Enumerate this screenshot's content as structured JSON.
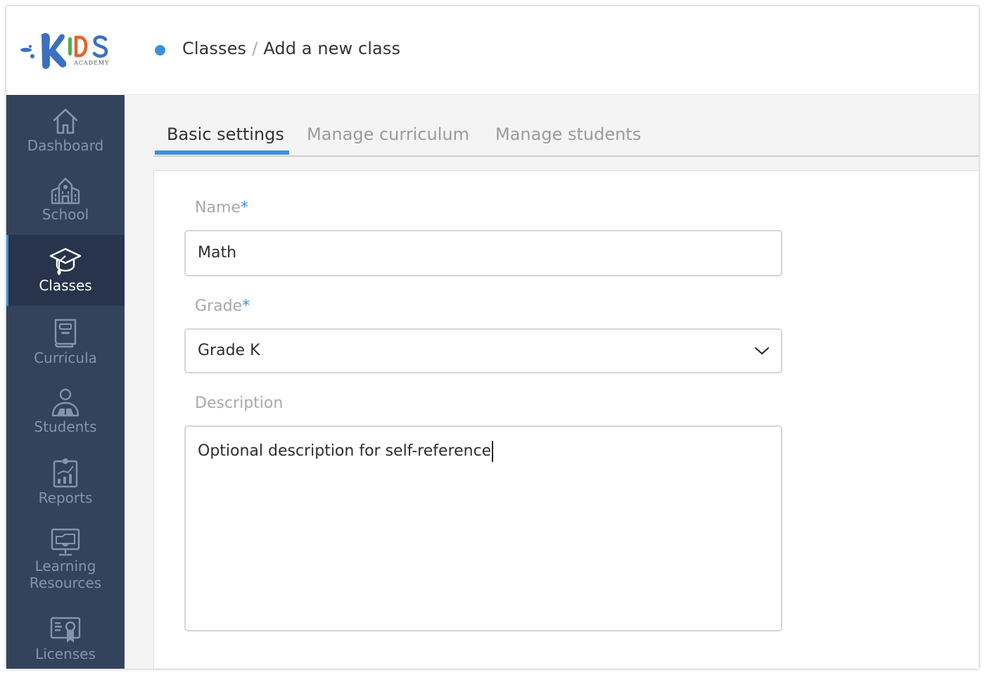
{
  "app": {
    "logo_text": "KIDS",
    "logo_subtext": "ACADEMY",
    "brand_colors": {
      "primary": "#3b6fc1",
      "green": "#4caf50",
      "orange": "#e8612c",
      "accent": "#3b92e0"
    }
  },
  "header": {
    "breadcrumb": {
      "parent": "Classes",
      "separator": "/",
      "current": "Add a new class"
    }
  },
  "sidebar": {
    "items": [
      {
        "label": "Dashboard",
        "icon": "home-icon",
        "active": false
      },
      {
        "label": "School",
        "icon": "school-building-icon",
        "active": false
      },
      {
        "label": "Classes",
        "icon": "graduation-cap-icon",
        "active": true
      },
      {
        "label": "Curricula",
        "icon": "book-icon",
        "active": false
      },
      {
        "label": "Students",
        "icon": "student-reading-icon",
        "active": false
      },
      {
        "label": "Reports",
        "icon": "report-chart-icon",
        "active": false
      },
      {
        "label": "Learning Resources",
        "label_line1": "Learning",
        "label_line2": "Resources",
        "icon": "monitor-folder-icon",
        "active": false
      },
      {
        "label": "Licenses",
        "icon": "certificate-icon",
        "active": false
      }
    ]
  },
  "tabs": [
    {
      "label": "Basic settings",
      "active": true
    },
    {
      "label": "Manage curriculum",
      "active": false
    },
    {
      "label": "Manage students",
      "active": false
    }
  ],
  "form": {
    "name": {
      "label": "Name",
      "required_mark": "*",
      "value": "Math"
    },
    "grade": {
      "label": "Grade",
      "required_mark": "*",
      "value": "Grade K"
    },
    "description": {
      "label": "Description",
      "value": "Optional description for self-reference"
    }
  }
}
